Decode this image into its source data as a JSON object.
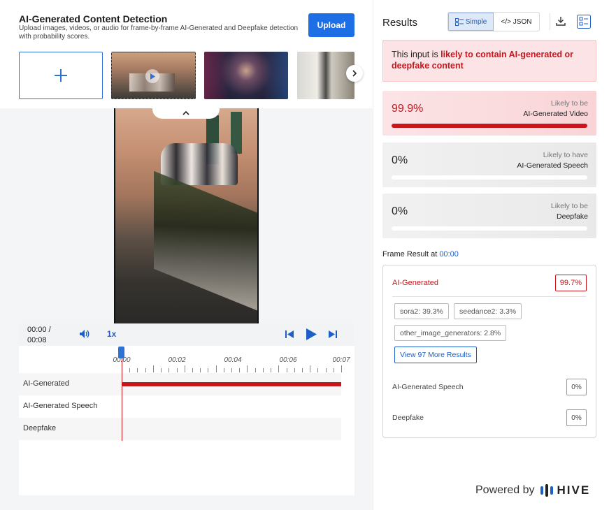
{
  "header": {
    "title": "AI-Generated Content Detection",
    "subtitle": "Upload images, videos, or audio for frame-by-frame AI-Generated and Deepfake detection with probability scores.",
    "upload_label": "Upload"
  },
  "gallery": {
    "add_icon": "plus-icon",
    "next_icon": "chevron-right-icon",
    "collapse_icon": "chevron-up-icon"
  },
  "player": {
    "current_time": "00:00 /",
    "duration": "00:08",
    "speed": "1x",
    "ruler_labels": [
      "00:00",
      "00:02",
      "00:04",
      "00:06",
      "00:07"
    ],
    "tracks": [
      {
        "label": "AI-Generated",
        "fill": 1.0
      },
      {
        "label": "AI-Generated Speech",
        "fill": 0
      },
      {
        "label": "Deepfake",
        "fill": 0
      }
    ]
  },
  "results": {
    "title": "Results",
    "toggle_simple": "Simple",
    "toggle_json": "</> JSON",
    "verdict_prefix": "This input is ",
    "verdict_strong": "likely to contain AI-generated or deepfake content",
    "scores": [
      {
        "pct": "99.9%",
        "line1": "Likely to be",
        "line2": "AI-Generated Video",
        "fill": 0.999,
        "style": "red"
      },
      {
        "pct": "0%",
        "line1": "Likely to have",
        "line2": "AI-Generated Speech",
        "fill": 0,
        "style": "gray"
      },
      {
        "pct": "0%",
        "line1": "Likely to be",
        "line2": "Deepfake",
        "fill": 0,
        "style": "gray"
      }
    ],
    "frame_heading": "Frame Result at ",
    "frame_time": "00:00",
    "frame": {
      "ai_label": "AI-Generated",
      "ai_value": "99.7%",
      "chips": [
        "sora2: 39.3%",
        "seedance2: 3.3%",
        "other_image_generators: 2.8%"
      ],
      "more_label": "View 97 More Results",
      "speech_label": "AI-Generated Speech",
      "speech_value": "0%",
      "deepfake_label": "Deepfake",
      "deepfake_value": "0%"
    }
  },
  "footer": {
    "powered_by": "Powered by",
    "brand": "HIVE"
  },
  "colors": {
    "accent": "#1e6ee6",
    "alert_red": "#c8161d",
    "alert_bg": "#fce4e6"
  }
}
